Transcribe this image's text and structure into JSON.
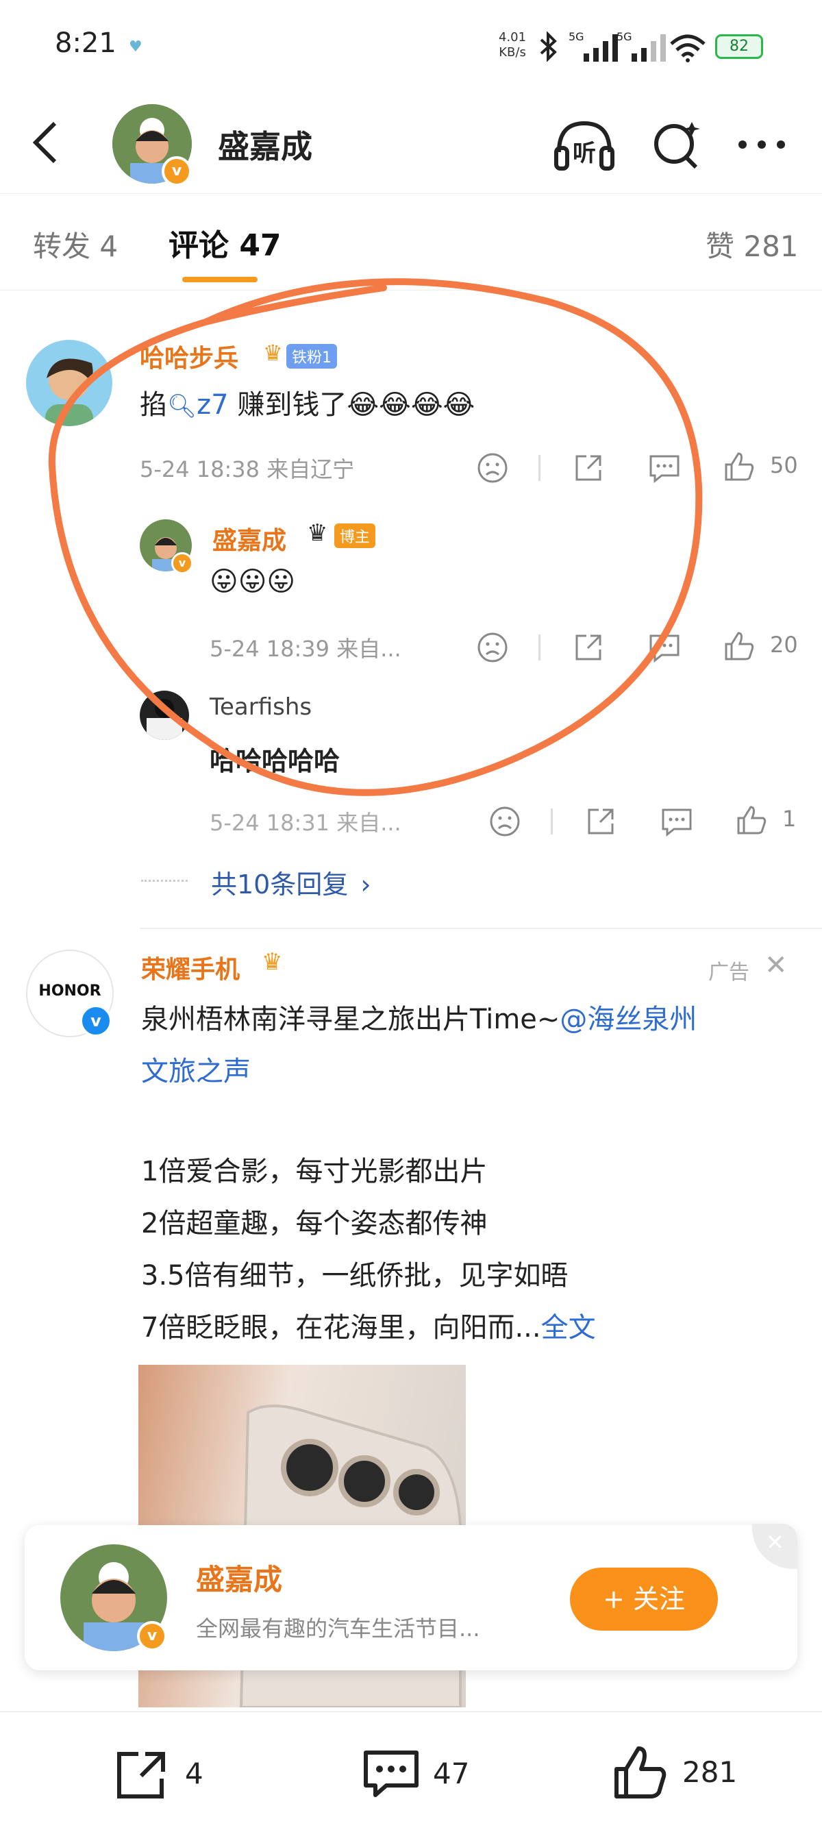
{
  "status_bar": {
    "time": "8:21",
    "net_speed_value": "4.01",
    "net_speed_unit": "KB/s",
    "sig1": "5G",
    "sig2": "5G",
    "battery": "82"
  },
  "header": {
    "title": "盛嘉成",
    "listen_label": "听"
  },
  "tabs": {
    "repost": "转发 4",
    "comments": "评论 47",
    "likes": "赞 281"
  },
  "comment1": {
    "user": "哈哈步兵",
    "fan_badge": "铁粉1",
    "text_pre": "掐",
    "search_term": "z7",
    "text_post": " 赚到钱了😂😂😂😂",
    "meta": "5-24 18:38 来自辽宁",
    "likes": "50"
  },
  "reply1": {
    "user": "盛嘉成",
    "badge": "博主",
    "text": "😛😛😛",
    "meta": "5-24 18:39 来自...",
    "likes": "20"
  },
  "reply2": {
    "user": "Tearfishs",
    "text": "哈哈哈哈哈",
    "meta": "5-24 18:31 来自...",
    "likes": "1"
  },
  "more_replies": "共10条回复",
  "ad": {
    "user": "荣耀手机",
    "logo_text": "HONOR",
    "ad_label": "广告",
    "line1_pre": "泉州梧林南洋寻星之旅出片Time~",
    "line1_link": "@海丝泉州",
    "line2_link": "文旅之声",
    "p1": "1倍爱合影，每寸光影都出片",
    "p2": "2倍超童趣，每个姿态都传神",
    "p3": "3.5倍有细节，一纸侨批，见字如晤",
    "p4_pre": "7倍眨眨眼，在花海里，向阳而...",
    "p4_link": "全文"
  },
  "follow_card": {
    "name": "盛嘉成",
    "desc": "全网最有趣的汽车生活节目...",
    "button": "+ 关注"
  },
  "bottom_bar": {
    "reposts": "4",
    "comments": "47",
    "likes": "281"
  },
  "colors": {
    "accent": "#f39a1f",
    "username": "#e8751a",
    "link": "#2f6ccf",
    "annotation_circle": "#f47a45"
  }
}
